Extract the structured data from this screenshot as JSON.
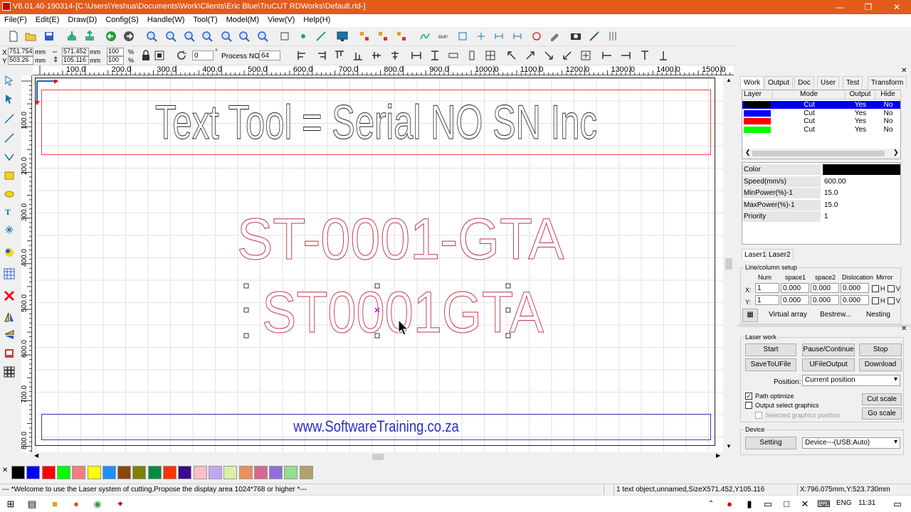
{
  "window": {
    "title": "V8.01.40-190314-[C:\\Users\\Yeshua\\Documents\\Work\\Clients\\Eric Blue\\TruCUT RDWorks\\Default.rld-]"
  },
  "menu": [
    "File(F)",
    "Edit(E)",
    "Draw(D)",
    "Config(S)",
    "Handle(W)",
    "Tool(T)",
    "Model(M)",
    "View(V)",
    "Help(H)"
  ],
  "props": {
    "x_label": "X",
    "x_value": "751.754",
    "x_unit": "mm",
    "y_label": "Y",
    "y_value": "503.26",
    "y_unit": "mm",
    "w_value": "571.452",
    "w_unit": "mm",
    "h_value": "105.116",
    "h_unit": "mm",
    "scale_x": "100",
    "scale_y": "100",
    "pct": "%",
    "rotate_value": "0",
    "degree": "°",
    "process_label": "Process NO:",
    "process_value": "64"
  },
  "ruler": {
    "h_ticks": [
      "100.0",
      "200.0",
      "300.0",
      "400.0",
      "500.0",
      "600.0",
      "700.0",
      "800.0",
      "900.0",
      "1000.0",
      "1100.0",
      "1200.0",
      "1300.0",
      "1400.0",
      "1500.0"
    ],
    "v_ticks": [
      "100.0",
      "200.0",
      "300.0",
      "400.0",
      "500.0",
      "600.0",
      "700.0",
      "800.0"
    ]
  },
  "canvas": {
    "header_text": "Text Tool = Serial NO SN Inc",
    "serial_text": "ST-0001-GTA",
    "selected_text": "ST0001GTA",
    "footer_text": "www.SoftwareTraining.co.za"
  },
  "palette": [
    "#000000",
    "#0000ff",
    "#ff0000",
    "#00ff00",
    "#f08080",
    "#ffff00",
    "#1e90ff",
    "#8b4513",
    "#808000",
    "#008b45",
    "#ff3300",
    "#3d0a8c",
    "#ffc0cb",
    "#c0a8f0",
    "#d8f0a8",
    "#e89060",
    "#d86890",
    "#9070d8",
    "#90e090",
    "#b0a070"
  ],
  "status": {
    "message": "--- *Welcome to use the Laser system of cutting,Propose the display area 1024*768 or higher *---",
    "selection": "1 text object,unnamed,SizeX571.452,Y105.116",
    "cursor": "X:796.075mm,Y:523.730mm"
  },
  "panel": {
    "tabs": [
      "Work",
      "Output",
      "Doc",
      "User",
      "Test",
      "Transform"
    ],
    "layer_headers": [
      "Layer",
      "Mode",
      "Output",
      "Hide"
    ],
    "layers": [
      {
        "color": "#000000",
        "mode": "Cut",
        "output": "Yes",
        "hide": "No"
      },
      {
        "color": "#0000ff",
        "mode": "Cut",
        "output": "Yes",
        "hide": "No"
      },
      {
        "color": "#ff0000",
        "mode": "Cut",
        "output": "Yes",
        "hide": "No"
      },
      {
        "color": "#00ff00",
        "mode": "Cut",
        "output": "Yes",
        "hide": "No"
      }
    ],
    "params": [
      {
        "label": "Color",
        "value": ""
      },
      {
        "label": "Speed(mm/s)",
        "value": "600.00"
      },
      {
        "label": "MinPower(%)-1",
        "value": "15.0"
      },
      {
        "label": "MaxPower(%)-1",
        "value": "15.0"
      },
      {
        "label": "Priority",
        "value": "1"
      }
    ],
    "laser_tabs": [
      "Laser1",
      "Laser2"
    ],
    "array": {
      "title": "Line/column setup",
      "headers": [
        "Num",
        "space1",
        "space2",
        "Dislocation",
        "Mirror"
      ],
      "x_label": "X:",
      "y_label": "Y:",
      "x_row": [
        "1",
        "0.000",
        "0.000",
        "0.000"
      ],
      "y_row": [
        "1",
        "0.000",
        "0.000",
        "0.000"
      ],
      "h": "H",
      "v": "V",
      "virtual_array": "Virtual array",
      "bestrew": "Bestrew...",
      "nesting": "Nesting"
    }
  },
  "laserwork": {
    "title": "Laser work",
    "start": "Start",
    "pause": "Pause/Continue",
    "stop": "Stop",
    "save_file": "SaveToUFile",
    "ufile_output": "UFileOutput",
    "download": "Download",
    "position_label": "Position:",
    "position_value": "Current position",
    "path_optimize": "Path optimize",
    "output_select": "Output select graphics",
    "selected_position": "Selected graphics position",
    "cut_scale": "Cut scale",
    "go_scale": "Go scale",
    "device_title": "Device",
    "setting": "Setting",
    "device_value": "Device---(USB:Auto)"
  },
  "taskbar": {
    "lang": "ENG",
    "time": "11:31"
  }
}
